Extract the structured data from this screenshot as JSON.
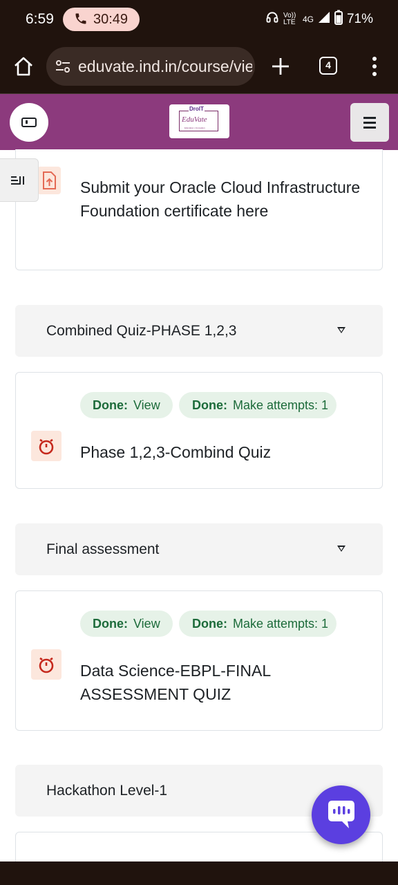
{
  "status_bar": {
    "time": "6:59",
    "call_timer": "30:49",
    "network": "4G",
    "volte": "Vo)) LTE",
    "battery": "71%"
  },
  "browser": {
    "url": "eduvate.ind.in/course/vie",
    "tab_count": "4"
  },
  "header": {
    "logo_top": "DroIT",
    "logo_text": "EduVate",
    "logo_tagline": "Education | Innovation"
  },
  "content": {
    "submit_activity": {
      "name": "Submit your Oracle Cloud Infrastructure Foundation certificate here",
      "icon": "assignment-upload-icon"
    },
    "sections": [
      {
        "title": "Combined Quiz-PHASE 1,2,3",
        "activity": {
          "name": "Phase 1,2,3-Combind Quiz",
          "icon": "quiz-timer-icon",
          "badges": [
            {
              "key": "Done:",
              "value": "View"
            },
            {
              "key": "Done:",
              "value": "Make attempts: 1"
            }
          ]
        }
      },
      {
        "title": "Final assessment",
        "activity": {
          "name": "Data Science-EBPL-FINAL ASSESSMENT QUIZ",
          "icon": "quiz-timer-icon",
          "badges": [
            {
              "key": "Done:",
              "value": "View"
            },
            {
              "key": "Done:",
              "value": "Make attempts: 1"
            }
          ]
        }
      },
      {
        "title": "Hackathon Level-1"
      }
    ]
  },
  "colors": {
    "header_bg": "#8c3a7d",
    "browser_bg": "#20130d",
    "badge_bg": "#e6f2e8",
    "badge_text": "#1c6b3a",
    "chat_fab": "#5b3fe0",
    "activity_icon_bg": "#fce7dd",
    "activity_icon_fg": "#c5281c"
  }
}
